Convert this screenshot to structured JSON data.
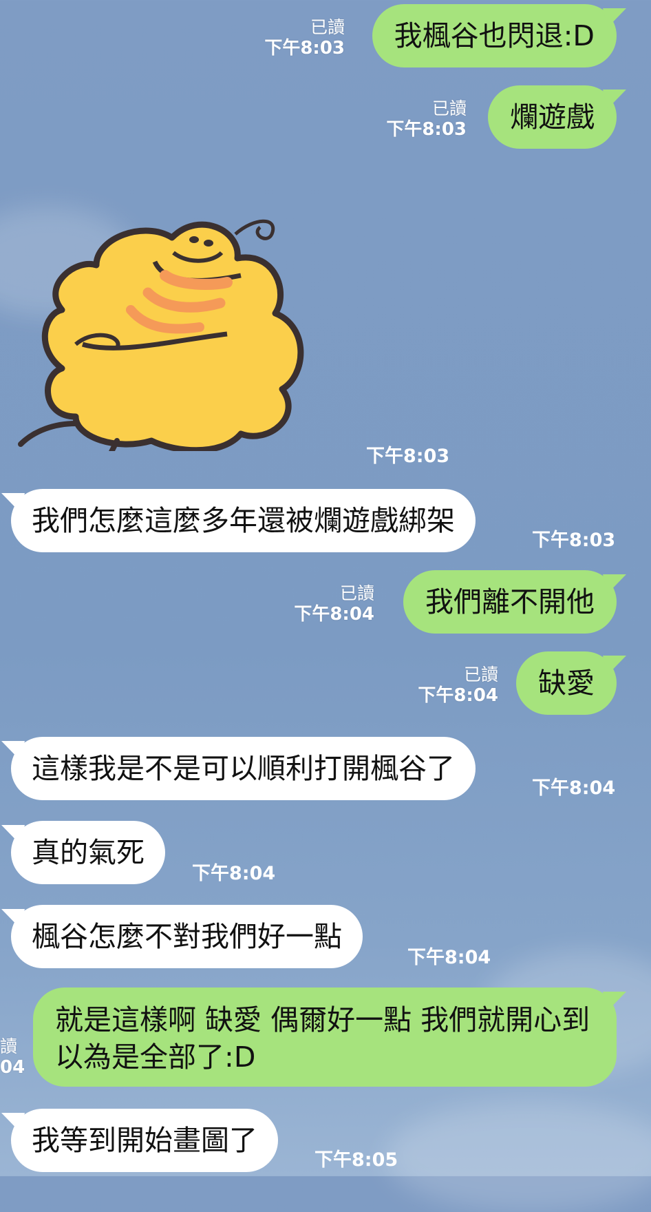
{
  "messages": [
    {
      "text": "我楓谷也閃退:D",
      "read": "已讀",
      "time": "下午8:03"
    },
    {
      "text": "爛遊戲",
      "read": "已讀",
      "time": "下午8:03"
    },
    {
      "sticker": "chick-hug-sticker",
      "time": "下午8:03"
    },
    {
      "text": "我們怎麼這麼多年還被爛遊戲綁架",
      "time": "下午8:03"
    },
    {
      "text": "我們離不開他",
      "read": "已讀",
      "time": "下午8:04"
    },
    {
      "text": "缺愛",
      "read": "已讀",
      "time": "下午8:04"
    },
    {
      "text": "這樣我是不是可以順利打開楓谷了",
      "time": "下午8:04"
    },
    {
      "text": "真的氣死",
      "time": "下午8:04"
    },
    {
      "text": "楓谷怎麼不對我們好一點",
      "time": "下午8:04"
    },
    {
      "text": "就是這樣啊 缺愛 偶爾好一點 我們就開心到以為是全部了:D",
      "read": "讀",
      "time": "04"
    },
    {
      "text": "我等到開始畫圖了",
      "time": "下午8:05"
    }
  ],
  "colors": {
    "sent": "#a6e37d",
    "received": "#ffffff",
    "background": "#7f9cc4"
  }
}
